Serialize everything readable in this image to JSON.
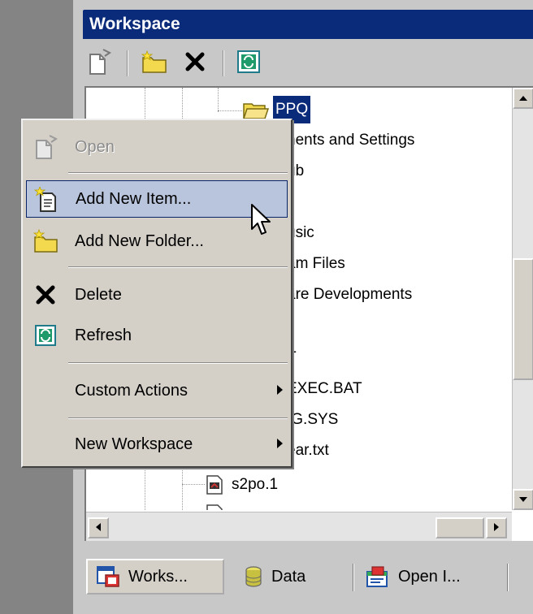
{
  "panel": {
    "title": "Workspace"
  },
  "toolbar": {
    "open_icon": "open-document-icon",
    "new_folder_icon": "new-folder-icon",
    "delete_icon": "delete-x-icon",
    "refresh_icon": "refresh-icon"
  },
  "tree": {
    "top_item": "PPQ",
    "partial_rows": [
      "hents and Settings",
      "ub",
      "usic",
      "am Files",
      "are Developments",
      "T",
      "EXEC.BAT",
      "IG.SYS",
      "ear.txt"
    ],
    "bottom_item": "s2po.1"
  },
  "context_menu": {
    "items": [
      {
        "label": "Open",
        "icon": "open-document-icon",
        "enabled": false
      },
      {
        "label": "Add New Item...",
        "icon": "new-item-icon",
        "enabled": true,
        "highlighted": true
      },
      {
        "label": "Add New Folder...",
        "icon": "new-folder-icon",
        "enabled": true
      },
      {
        "label": "Delete",
        "icon": "delete-x-icon",
        "enabled": true
      },
      {
        "label": "Refresh",
        "icon": "refresh-icon",
        "enabled": true
      },
      {
        "label": "Custom Actions",
        "submenu": true
      },
      {
        "label": "New Workspace",
        "submenu": true
      }
    ]
  },
  "tabs": [
    {
      "label": "Works...",
      "icon": "workspace-icon",
      "active": true
    },
    {
      "label": "Data",
      "icon": "database-icon",
      "active": false
    },
    {
      "label": "Open I...",
      "icon": "open-items-icon",
      "active": false
    }
  ],
  "colors": {
    "title_bar": "#0a2a7a",
    "selection": "#0a2a7a",
    "menu_background": "#d4d0c8",
    "menu_highlight": "#b9c5dc"
  }
}
